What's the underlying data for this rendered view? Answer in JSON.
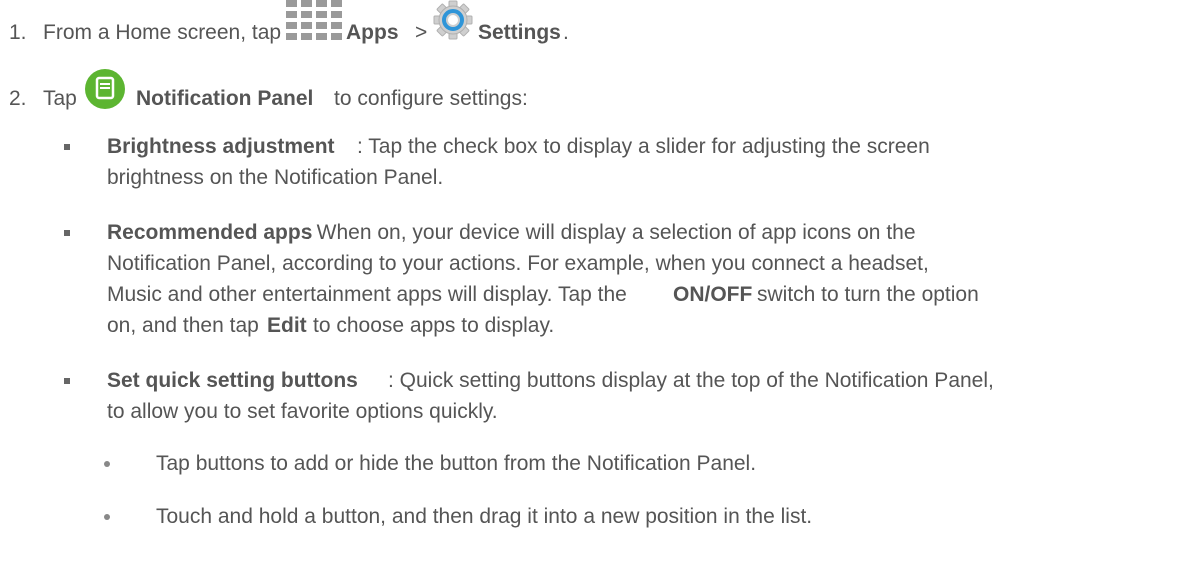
{
  "steps": [
    {
      "number": "1.",
      "text_before": "From a Home screen, tap",
      "apps_label": "Apps",
      "separator": ">",
      "settings_label": "Settings",
      "end": "."
    },
    {
      "number": "2.",
      "text_before": "Tap",
      "panel_label": "Notification Panel",
      "text_after": "to configure settings:"
    }
  ],
  "bullets": [
    {
      "title": "Brightness adjustment",
      "lines": [
        ": Tap the check box to display a slider for adjusting the screen",
        "brightness on the Notification Panel."
      ]
    },
    {
      "title": "Recommended apps",
      "lines": [
        ": When on, your device will display a selection of app icons on the",
        "Notification Panel, according to your actions. For example, when you connect a headset,",
        "Music and other entertainment apps will display. Tap the",
        "switch to turn the option",
        "on, and then tap",
        "to choose apps to display."
      ],
      "onoff_label": "ON/OFF",
      "edit_label": "Edit"
    },
    {
      "title": "Set quick setting buttons",
      "lines": [
        ": Quick setting buttons display at the top of the Notification Panel,",
        "to allow you to set favorite options quickly."
      ]
    }
  ],
  "sub_bullets": [
    "Tap buttons to add or hide the button from the Notification Panel.",
    "Touch and hold a button, and then drag it into a new position in the list."
  ],
  "icons": {
    "apps": "apps-grid-icon",
    "settings": "settings-gear-icon",
    "notification_panel": "notification-panel-icon"
  },
  "colors": {
    "text": "#555555",
    "gear": "#2f95d8",
    "panel_green": "#5cb531"
  }
}
